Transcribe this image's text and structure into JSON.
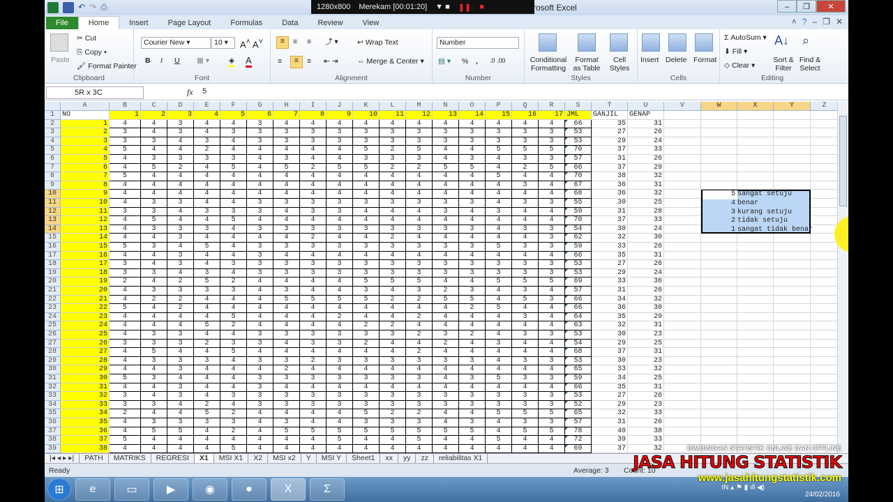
{
  "recorder": {
    "resolution": "1280x800",
    "status": "Merekam [00:01:20]"
  },
  "window": {
    "title": "rosoft Excel"
  },
  "ribbon_tabs": [
    "File",
    "Home",
    "Insert",
    "Page Layout",
    "Formulas",
    "Data",
    "Review",
    "View"
  ],
  "ribbon": {
    "clipboard": {
      "label": "Clipboard",
      "paste": "Paste",
      "cut": "Cut",
      "copy": "Copy",
      "format_painter": "Format Painter"
    },
    "font": {
      "label": "Font",
      "font_name": "Courier New",
      "font_size": "10",
      "bold": "B",
      "italic": "I",
      "underline": "U"
    },
    "alignment": {
      "label": "Alignment",
      "wrap_text": "Wrap Text",
      "merge_center": "Merge & Center"
    },
    "number": {
      "label": "Number",
      "format": "Number",
      "percent": "%",
      "comma": ","
    },
    "styles": {
      "label": "Styles",
      "conditional_formatting": "Conditional Formatting",
      "format_as_table": "Format as Table",
      "cell_styles": "Cell Styles"
    },
    "cells": {
      "label": "Cells",
      "insert": "Insert",
      "delete": "Delete",
      "format": "Format"
    },
    "editing": {
      "label": "Editing",
      "autosum": "AutoSum",
      "fill": "Fill",
      "clear": "Clear",
      "sort_filter": "Sort & Filter",
      "find_select": "Find & Select"
    }
  },
  "formula_bar": {
    "name_box": "5R x 3C",
    "fx": "fx",
    "value": "5"
  },
  "grid": {
    "columns": [
      "A",
      "B",
      "C",
      "D",
      "E",
      "F",
      "G",
      "H",
      "I",
      "J",
      "K",
      "L",
      "M",
      "N",
      "O",
      "P",
      "Q",
      "R",
      "S",
      "T",
      "U",
      "V",
      "W",
      "X",
      "Y",
      "Z"
    ],
    "header_row": [
      "NO",
      "1",
      "2",
      "3",
      "4",
      "5",
      "6",
      "7",
      "8",
      "9",
      "10",
      "11",
      "12",
      "13",
      "14",
      "15",
      "16",
      "17",
      "JML",
      "GANJIL",
      "GENAP"
    ],
    "rows": [
      [
        1,
        4,
        4,
        3,
        4,
        4,
        3,
        4,
        4,
        4,
        4,
        4,
        4,
        4,
        4,
        4,
        4,
        4,
        66,
        35,
        31
      ],
      [
        2,
        3,
        4,
        3,
        4,
        3,
        3,
        3,
        3,
        3,
        3,
        3,
        3,
        3,
        3,
        3,
        3,
        3,
        53,
        27,
        26
      ],
      [
        3,
        3,
        3,
        4,
        3,
        4,
        3,
        3,
        3,
        3,
        3,
        3,
        3,
        3,
        3,
        3,
        3,
        3,
        53,
        29,
        24
      ],
      [
        4,
        5,
        4,
        4,
        2,
        4,
        4,
        4,
        4,
        4,
        5,
        2,
        5,
        4,
        4,
        5,
        5,
        5,
        70,
        37,
        33
      ],
      [
        5,
        4,
        3,
        3,
        3,
        3,
        4,
        3,
        4,
        4,
        3,
        3,
        3,
        4,
        3,
        4,
        3,
        3,
        57,
        31,
        26
      ],
      [
        6,
        4,
        5,
        2,
        4,
        5,
        4,
        5,
        2,
        5,
        5,
        2,
        2,
        5,
        5,
        4,
        2,
        5,
        66,
        37,
        29
      ],
      [
        7,
        5,
        4,
        4,
        4,
        4,
        4,
        4,
        4,
        4,
        4,
        4,
        4,
        4,
        4,
        5,
        4,
        4,
        70,
        38,
        32
      ],
      [
        8,
        4,
        4,
        4,
        4,
        4,
        4,
        4,
        4,
        4,
        4,
        4,
        4,
        4,
        4,
        4,
        3,
        4,
        67,
        36,
        31
      ],
      [
        9,
        4,
        4,
        4,
        4,
        4,
        4,
        4,
        4,
        4,
        4,
        4,
        4,
        4,
        4,
        4,
        4,
        4,
        68,
        36,
        32
      ],
      [
        10,
        4,
        3,
        3,
        4,
        4,
        3,
        3,
        3,
        3,
        3,
        3,
        3,
        3,
        3,
        4,
        3,
        3,
        55,
        30,
        25
      ],
      [
        11,
        3,
        3,
        4,
        3,
        3,
        3,
        4,
        3,
        3,
        4,
        4,
        4,
        3,
        4,
        3,
        4,
        4,
        59,
        31,
        28
      ],
      [
        12,
        4,
        5,
        4,
        4,
        5,
        4,
        4,
        4,
        4,
        4,
        4,
        4,
        4,
        4,
        4,
        4,
        4,
        70,
        37,
        33
      ],
      [
        13,
        4,
        3,
        3,
        3,
        4,
        3,
        3,
        3,
        3,
        3,
        3,
        3,
        3,
        3,
        4,
        3,
        3,
        54,
        30,
        24
      ],
      [
        14,
        4,
        4,
        3,
        4,
        4,
        4,
        4,
        2,
        4,
        4,
        2,
        4,
        4,
        4,
        4,
        4,
        3,
        62,
        32,
        30
      ],
      [
        15,
        5,
        3,
        4,
        5,
        4,
        3,
        3,
        3,
        3,
        3,
        3,
        3,
        3,
        3,
        5,
        3,
        3,
        59,
        33,
        26
      ],
      [
        16,
        4,
        4,
        3,
        4,
        4,
        3,
        4,
        4,
        4,
        4,
        4,
        4,
        4,
        4,
        4,
        4,
        4,
        66,
        35,
        31
      ],
      [
        17,
        3,
        4,
        3,
        4,
        3,
        3,
        3,
        3,
        3,
        3,
        3,
        3,
        3,
        3,
        3,
        3,
        3,
        53,
        27,
        26
      ],
      [
        18,
        3,
        3,
        4,
        3,
        4,
        3,
        3,
        3,
        3,
        3,
        3,
        3,
        3,
        3,
        3,
        3,
        3,
        53,
        29,
        24
      ],
      [
        19,
        2,
        4,
        2,
        5,
        2,
        4,
        4,
        4,
        4,
        5,
        5,
        5,
        4,
        4,
        5,
        5,
        5,
        69,
        33,
        36
      ],
      [
        20,
        4,
        3,
        3,
        3,
        3,
        4,
        3,
        4,
        4,
        3,
        4,
        3,
        2,
        3,
        4,
        3,
        4,
        57,
        31,
        26
      ],
      [
        21,
        4,
        2,
        2,
        4,
        4,
        4,
        5,
        5,
        5,
        5,
        2,
        2,
        5,
        5,
        4,
        5,
        3,
        66,
        34,
        32
      ],
      [
        22,
        5,
        4,
        2,
        4,
        4,
        4,
        4,
        4,
        4,
        4,
        4,
        4,
        4,
        2,
        5,
        4,
        4,
        66,
        36,
        30
      ],
      [
        23,
        4,
        4,
        4,
        4,
        5,
        4,
        4,
        4,
        2,
        4,
        4,
        2,
        4,
        4,
        4,
        3,
        4,
        64,
        35,
        29
      ],
      [
        24,
        4,
        4,
        4,
        5,
        2,
        4,
        4,
        4,
        4,
        2,
        2,
        4,
        4,
        4,
        4,
        4,
        4,
        63,
        32,
        31
      ],
      [
        25,
        4,
        3,
        3,
        4,
        4,
        3,
        3,
        3,
        3,
        3,
        3,
        2,
        3,
        2,
        4,
        3,
        3,
        53,
        30,
        23
      ],
      [
        26,
        3,
        3,
        3,
        2,
        3,
        3,
        4,
        3,
        3,
        2,
        4,
        4,
        2,
        4,
        3,
        4,
        4,
        54,
        29,
        25
      ],
      [
        27,
        4,
        5,
        4,
        4,
        5,
        4,
        4,
        4,
        4,
        4,
        4,
        2,
        4,
        4,
        4,
        4,
        4,
        68,
        37,
        31
      ],
      [
        28,
        4,
        3,
        3,
        3,
        4,
        3,
        3,
        2,
        3,
        3,
        3,
        3,
        3,
        3,
        4,
        3,
        3,
        53,
        30,
        23
      ],
      [
        29,
        4,
        4,
        3,
        4,
        4,
        4,
        2,
        4,
        4,
        4,
        4,
        4,
        4,
        4,
        4,
        4,
        4,
        65,
        33,
        32
      ],
      [
        30,
        5,
        3,
        4,
        4,
        4,
        3,
        3,
        3,
        3,
        3,
        3,
        3,
        4,
        3,
        5,
        3,
        3,
        59,
        34,
        25
      ],
      [
        31,
        4,
        4,
        3,
        4,
        4,
        3,
        4,
        4,
        4,
        4,
        4,
        4,
        4,
        4,
        4,
        4,
        4,
        66,
        35,
        31
      ],
      [
        32,
        3,
        4,
        3,
        4,
        3,
        3,
        3,
        3,
        3,
        3,
        3,
        3,
        3,
        3,
        3,
        3,
        3,
        53,
        27,
        26
      ],
      [
        33,
        3,
        3,
        4,
        2,
        4,
        3,
        3,
        3,
        3,
        3,
        3,
        3,
        3,
        3,
        3,
        3,
        3,
        52,
        29,
        23
      ],
      [
        34,
        2,
        4,
        4,
        5,
        2,
        4,
        4,
        4,
        4,
        5,
        2,
        2,
        4,
        4,
        5,
        5,
        5,
        65,
        32,
        33
      ],
      [
        35,
        4,
        3,
        3,
        3,
        3,
        4,
        3,
        4,
        4,
        3,
        3,
        3,
        4,
        3,
        4,
        3,
        3,
        57,
        31,
        26
      ],
      [
        36,
        4,
        5,
        5,
        4,
        2,
        4,
        5,
        5,
        5,
        5,
        5,
        5,
        5,
        5,
        4,
        5,
        5,
        78,
        40,
        38
      ],
      [
        37,
        5,
        4,
        4,
        4,
        4,
        4,
        4,
        4,
        5,
        4,
        4,
        5,
        4,
        4,
        5,
        4,
        4,
        72,
        39,
        33
      ],
      [
        38,
        4,
        4,
        4,
        4,
        5,
        4,
        4,
        4,
        4,
        4,
        4,
        4,
        4,
        4,
        4,
        4,
        4,
        69,
        37,
        32
      ]
    ],
    "legend": [
      "5 sangat setuju",
      "4 benar",
      "3 kurang setuju",
      "2 tidak setuju",
      "1 sangat tidak benar"
    ]
  },
  "sheets": [
    "PATH",
    "MATRIKS",
    "REGRESI",
    "X1",
    "MSI X1",
    "X2",
    "MSI x2",
    "Y",
    "MSI Y",
    "Sheet1",
    "xx",
    "yy",
    "zz",
    "reliabilitas X1"
  ],
  "active_sheet": "X1",
  "status": {
    "mode": "Ready",
    "average": "Average: 3",
    "count": "Count: 10"
  },
  "watermark": {
    "line1": "BIMBINGAN STATISTIK ONLINE DAN OFFLINE",
    "line2": "JASA HITUNG STATISTIK",
    "line3": "www.jasahitungstatistik.com"
  },
  "tray": {
    "lang": "IN",
    "date": "24/02/2016"
  },
  "colors": {
    "highlight": "#ffff00",
    "selection": "#bcd7f5",
    "file_tab": "#2d8a2d"
  }
}
